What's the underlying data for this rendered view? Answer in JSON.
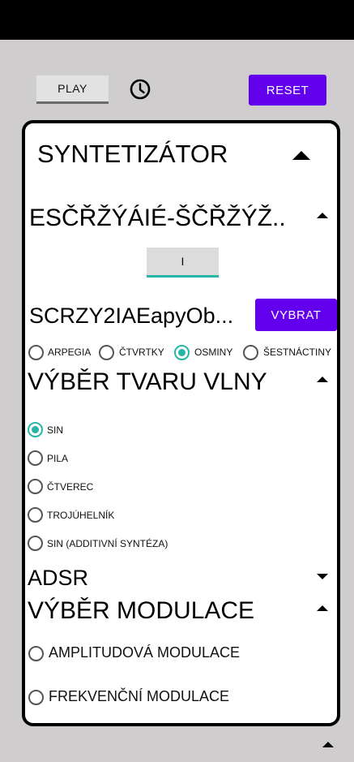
{
  "topbar": {
    "play_label": "PLAY",
    "clock_icon": "clock-icon",
    "reset_label": "RESET"
  },
  "card": {
    "synth_title": "SYNTETIZÁTOR",
    "preset_title": "ESČŘŽÝÁIÉ-ŠČŘŽÝŽ..",
    "i_button_label": "I",
    "sample_title": "SCRZY2IAEapyOb...",
    "vybrat_label": "VYBRAT",
    "rhythm": {
      "options": [
        "ARPEGIA",
        "ČTVRTKY",
        "OSMINY",
        "ŠESTNÁCTINY"
      ],
      "selected": "OSMINY"
    },
    "wave_title": "VÝBĚR TVARU VLNY",
    "wave": {
      "options": [
        "SIN",
        "PILA",
        "ČTVEREC",
        "TROJÚHELNÍK",
        "SIN (ADDITIVNÍ SYNTÉZA)"
      ],
      "selected": "SIN"
    },
    "adsr_title": "ADSR",
    "mod_title": "VÝBĚR MODULACE",
    "modulation": {
      "options": [
        "AMPLITUDOVÁ MODULACE",
        "FREKVENČNÍ MODULACE"
      ]
    }
  },
  "colors": {
    "accent": "#6200ee",
    "radio_selected": "#26b5a6",
    "background": "#cfcdcd"
  }
}
